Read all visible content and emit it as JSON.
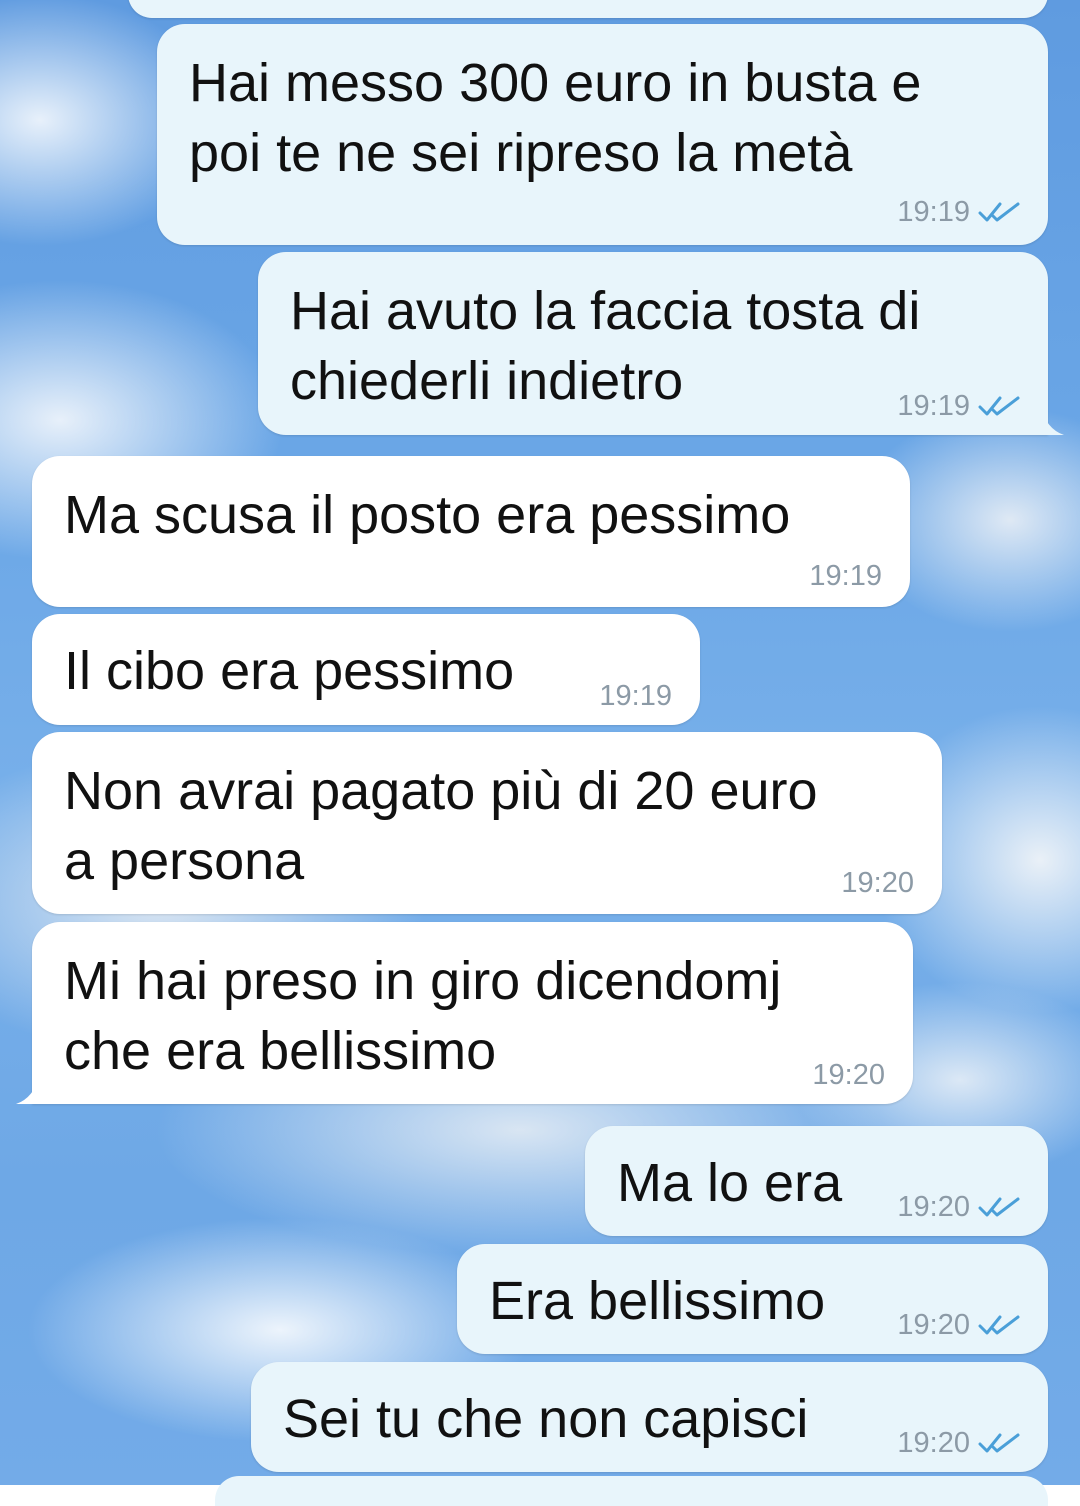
{
  "conversation": {
    "messages": [
      {
        "direction": "outgoing",
        "text": "Hai messo 300 euro in busta e\npoi te ne sei ripreso la metà",
        "time": "19:19",
        "status": "read"
      },
      {
        "direction": "outgoing",
        "text": "Hai avuto la faccia tosta di\nchiederli indietro",
        "time": "19:19",
        "status": "read"
      },
      {
        "direction": "incoming",
        "text": "Ma scusa il posto era pessimo",
        "time": "19:19"
      },
      {
        "direction": "incoming",
        "text": "Il cibo era pessimo",
        "time": "19:19"
      },
      {
        "direction": "incoming",
        "text": "Non avrai pagato più di 20 euro\na persona",
        "time": "19:20"
      },
      {
        "direction": "incoming",
        "text": "Mi hai preso in giro dicendomj\nche era bellissimo",
        "time": "19:20"
      },
      {
        "direction": "outgoing",
        "text": "Ma lo era",
        "time": "19:20",
        "status": "read"
      },
      {
        "direction": "outgoing",
        "text": "Era bellissimo",
        "time": "19:20",
        "status": "read"
      },
      {
        "direction": "outgoing",
        "text": "Sei tu che non capisci",
        "time": "19:20",
        "status": "read"
      }
    ]
  },
  "colors": {
    "outgoing_bubble": "#e8f5fb",
    "incoming_bubble": "#ffffff",
    "read_ticks": "#4a9fd8",
    "timestamp": "#8c9aa6"
  },
  "icons": {
    "read_receipt": "double-check-icon"
  }
}
